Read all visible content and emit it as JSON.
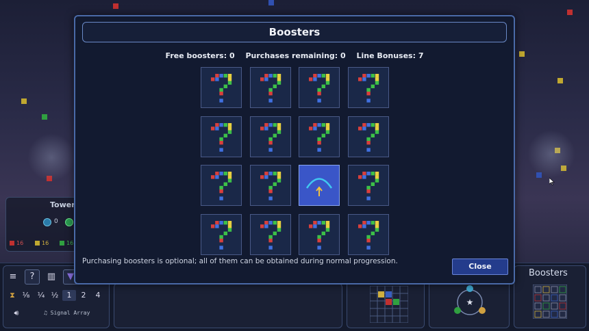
{
  "modal": {
    "title": "Boosters",
    "stats": {
      "free": "Free boosters: 0",
      "purchases": "Purchases remaining: 0",
      "line_bonuses": "Line Bonuses: 7"
    },
    "cards": [
      {
        "type": "mystery"
      },
      {
        "type": "mystery"
      },
      {
        "type": "mystery"
      },
      {
        "type": "mystery"
      },
      {
        "type": "mystery"
      },
      {
        "type": "mystery"
      },
      {
        "type": "mystery"
      },
      {
        "type": "mystery"
      },
      {
        "type": "mystery"
      },
      {
        "type": "mystery"
      },
      {
        "type": "arc-up-icon",
        "selected": true
      },
      {
        "type": "mystery"
      },
      {
        "type": "mystery"
      },
      {
        "type": "mystery"
      },
      {
        "type": "mystery"
      },
      {
        "type": "mystery"
      }
    ],
    "note": "Purchasing boosters is optional; all of them can be obtained during normal progression.",
    "close_label": "Close"
  },
  "tower_panel": {
    "title": "Tower",
    "counts": [
      "0"
    ],
    "resources": [
      "16",
      "16",
      "16"
    ]
  },
  "controls": {
    "help_label": "?",
    "speeds": [
      "⅛",
      "¼",
      "½",
      "1",
      "2",
      "4"
    ],
    "active_speed": "1",
    "track": "Signal Array"
  },
  "boosters_tab": {
    "label": "Boosters"
  },
  "colors": {
    "red": "#d8403c",
    "yellow": "#e8d040",
    "green": "#3cc048",
    "blue": "#4070e0",
    "accent": "#4a6aa8",
    "selected": "#3a56c8"
  }
}
